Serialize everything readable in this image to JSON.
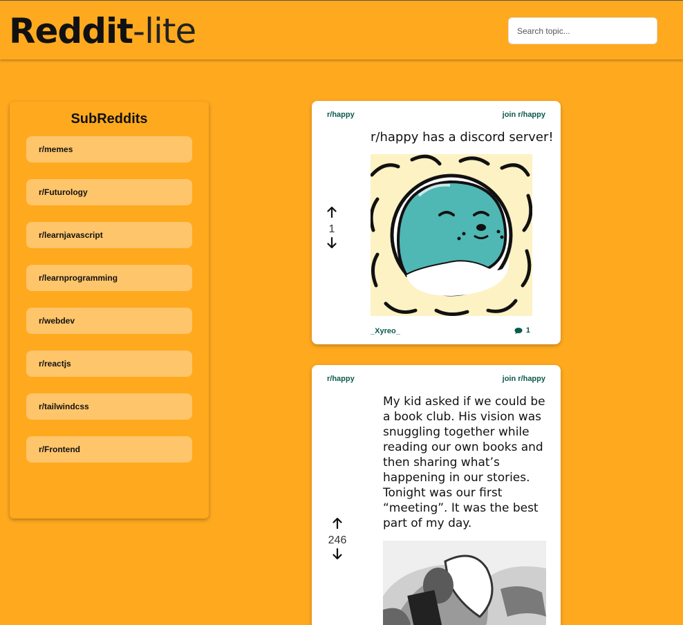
{
  "header": {
    "logo_bold": "Reddit",
    "logo_light": "-lite",
    "search_placeholder": "Search topic..."
  },
  "sidebar": {
    "title": "SubReddits",
    "items": [
      {
        "label": "r/memes"
      },
      {
        "label": "r/Futurology"
      },
      {
        "label": "r/learnjavascript"
      },
      {
        "label": "r/learnprogramming"
      },
      {
        "label": "r/webdev"
      },
      {
        "label": "r/reactjs"
      },
      {
        "label": "r/tailwindcss"
      },
      {
        "label": "r/Frontend"
      }
    ]
  },
  "posts": [
    {
      "subreddit": "r/happy",
      "join_label": "join r/happy",
      "votes": "1",
      "title": "r/happy has a discord server!",
      "author": "_Xyreo_",
      "comments": "1"
    },
    {
      "subreddit": "r/happy",
      "join_label": "join r/happy",
      "votes": "246",
      "title": "My kid asked if we could be a book club. His vision was snuggling together while reading our own books and then sharing what’s happening in our stories. Tonight was our first “meeting”. It was the best part of my day."
    }
  ],
  "colors": {
    "background": "#FFA91F",
    "subreddit_item": "#FFC56B",
    "link": "#0C5A4D",
    "card": "#FFFFFF"
  },
  "icons": [
    "arrow-up-icon",
    "arrow-down-icon",
    "comment-icon"
  ]
}
